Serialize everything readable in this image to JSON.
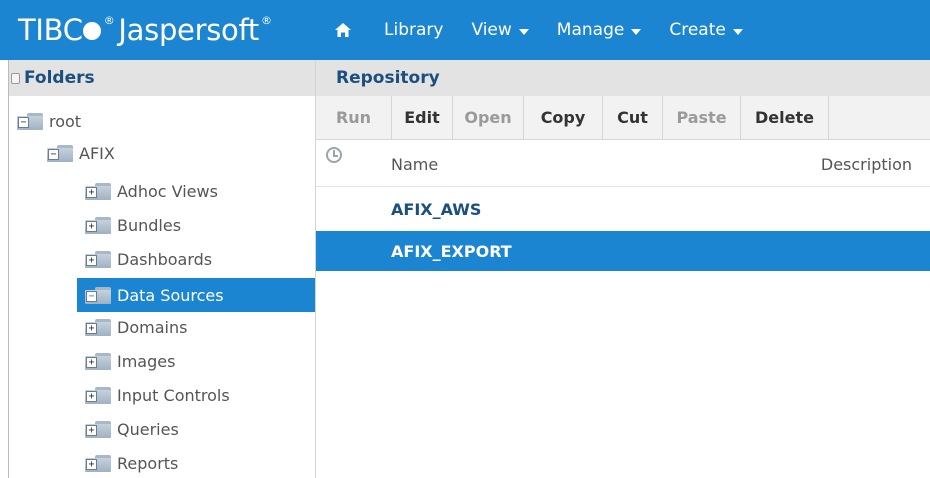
{
  "app": {
    "logo_text": "TIBC",
    "logo_suffix": "Jaspersoft",
    "logo_tm": "®"
  },
  "nav": {
    "items": [
      {
        "label": "Library",
        "has_menu": false
      },
      {
        "label": "View",
        "has_menu": true
      },
      {
        "label": "Manage",
        "has_menu": true
      },
      {
        "label": "Create",
        "has_menu": true
      }
    ]
  },
  "folders": {
    "title": "Folders",
    "tree": [
      {
        "label": "root",
        "level": 0,
        "state": "expanded",
        "selected": false
      },
      {
        "label": "AFIX",
        "level": 1,
        "state": "expanded",
        "selected": false
      },
      {
        "label": "Adhoc Views",
        "level": 2,
        "state": "collapsed",
        "selected": false
      },
      {
        "label": "Bundles",
        "level": 2,
        "state": "collapsed",
        "selected": false
      },
      {
        "label": "Dashboards",
        "level": 2,
        "state": "collapsed",
        "selected": false
      },
      {
        "label": "Data Sources",
        "level": 2,
        "state": "expanded",
        "selected": true
      },
      {
        "label": "Domains",
        "level": 2,
        "state": "collapsed",
        "selected": false
      },
      {
        "label": "Images",
        "level": 2,
        "state": "collapsed",
        "selected": false
      },
      {
        "label": "Input Controls",
        "level": 2,
        "state": "collapsed",
        "selected": false
      },
      {
        "label": "Queries",
        "level": 2,
        "state": "collapsed",
        "selected": false
      },
      {
        "label": "Reports",
        "level": 2,
        "state": "collapsed",
        "selected": false
      }
    ]
  },
  "repository": {
    "title": "Repository",
    "toolbar": [
      {
        "label": "Run",
        "enabled": false
      },
      {
        "label": "Edit",
        "enabled": true
      },
      {
        "label": "Open",
        "enabled": false
      },
      {
        "label": "Copy",
        "enabled": true
      },
      {
        "label": "Cut",
        "enabled": true
      },
      {
        "label": "Paste",
        "enabled": false
      },
      {
        "label": "Delete",
        "enabled": true
      }
    ],
    "columns": {
      "name": "Name",
      "description": "Description"
    },
    "rows": [
      {
        "name": "AFIX_AWS",
        "selected": false
      },
      {
        "name": "AFIX_EXPORT",
        "selected": true
      }
    ]
  },
  "colors": {
    "accent": "#1c85d1",
    "header_bg": "#e3e3e3",
    "link_text": "#1a4f80"
  }
}
